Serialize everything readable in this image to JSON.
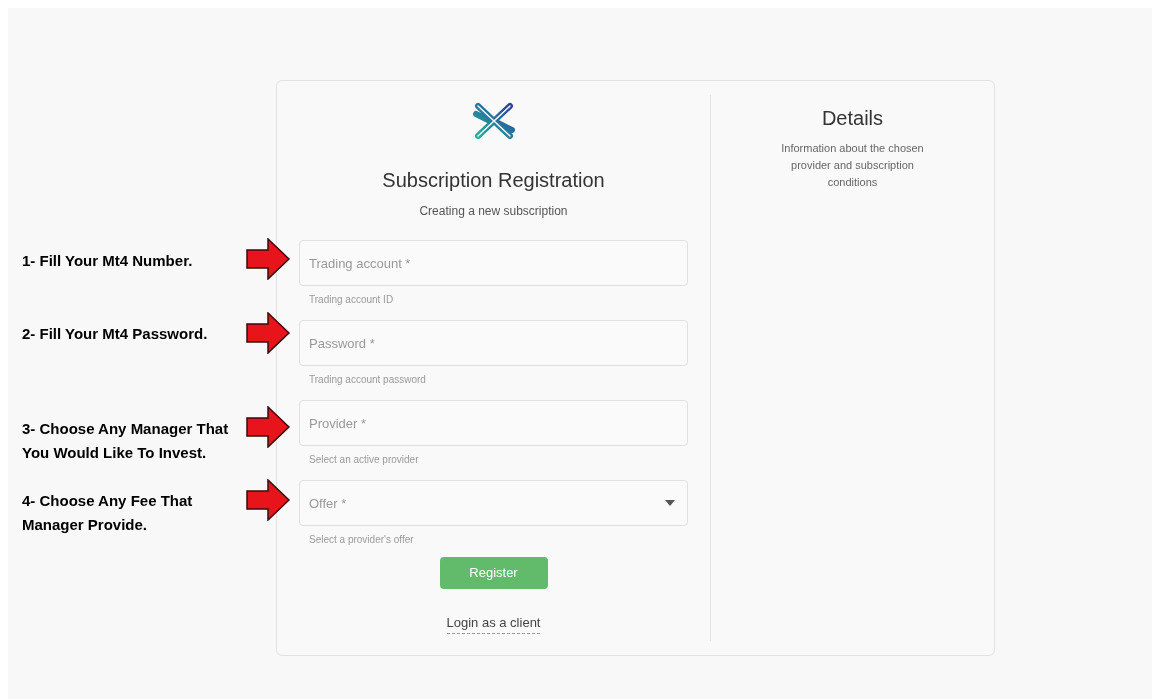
{
  "form": {
    "title": "Subscription Registration",
    "subtitle": "Creating a new subscription",
    "fields": [
      {
        "kind": "text",
        "placeholder": "Trading account *",
        "helper": "Trading account ID"
      },
      {
        "kind": "text",
        "placeholder": "Password *",
        "helper": "Trading account password"
      },
      {
        "kind": "text",
        "placeholder": "Provider *",
        "helper": "Select an active provider"
      },
      {
        "kind": "select",
        "placeholder": "Offer *",
        "helper": "Select a provider's offer"
      }
    ],
    "submit": "Register",
    "login_link": "Login as a client"
  },
  "details": {
    "title": "Details",
    "text": "Information about the chosen provider and subscription conditions"
  },
  "annotations": [
    {
      "text": "1- Fill Your Mt4 Number."
    },
    {
      "text": "2- Fill Your Mt4 Password."
    },
    {
      "text": "3- Choose Any Manager That You Would Like To Invest."
    },
    {
      "text": "4- Choose Any Fee That Manager Provide."
    }
  ]
}
